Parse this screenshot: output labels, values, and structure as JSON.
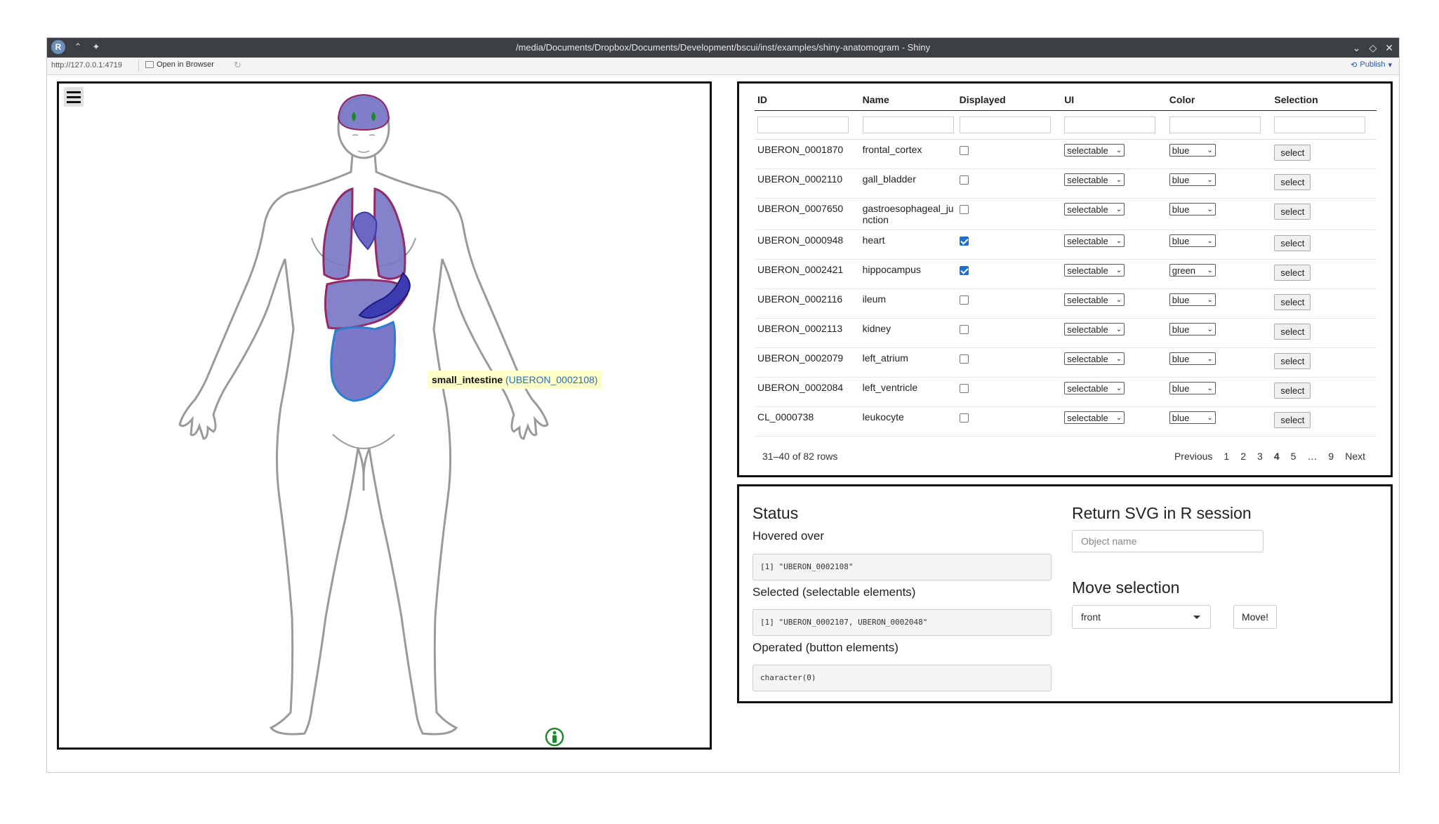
{
  "window": {
    "title": "/media/Documents/Dropbox/Documents/Development/bscui/inst/examples/shiny-anatomogram - Shiny",
    "url": "http://127.0.0.1:4719",
    "open_in_browser": "Open in Browser",
    "publish": "Publish",
    "r_logo": "R"
  },
  "anatomogram": {
    "tooltip_name": "small_intestine",
    "tooltip_id": "(UBERON_0002108)",
    "icons": [
      "menu-icon",
      "accessibility-icon"
    ]
  },
  "table": {
    "headers": [
      "ID",
      "Name",
      "Displayed",
      "UI",
      "Color",
      "Selection"
    ],
    "rows": [
      {
        "id": "UBERON_0001870",
        "name": "frontal_cortex",
        "displayed": false,
        "ui": "selectable",
        "color": "blue",
        "selection": "select"
      },
      {
        "id": "UBERON_0002110",
        "name": "gall_bladder",
        "displayed": false,
        "ui": "selectable",
        "color": "blue",
        "selection": "select"
      },
      {
        "id": "UBERON_0007650",
        "name": "gastroesophageal_junction",
        "displayed": false,
        "ui": "selectable",
        "color": "blue",
        "selection": "select"
      },
      {
        "id": "UBERON_0000948",
        "name": "heart",
        "displayed": true,
        "ui": "selectable",
        "color": "blue",
        "selection": "select"
      },
      {
        "id": "UBERON_0002421",
        "name": "hippocampus",
        "displayed": true,
        "ui": "selectable",
        "color": "green",
        "selection": "select"
      },
      {
        "id": "UBERON_0002116",
        "name": "ileum",
        "displayed": false,
        "ui": "selectable",
        "color": "blue",
        "selection": "select"
      },
      {
        "id": "UBERON_0002113",
        "name": "kidney",
        "displayed": false,
        "ui": "selectable",
        "color": "blue",
        "selection": "select"
      },
      {
        "id": "UBERON_0002079",
        "name": "left_atrium",
        "displayed": false,
        "ui": "selectable",
        "color": "blue",
        "selection": "select"
      },
      {
        "id": "UBERON_0002084",
        "name": "left_ventricle",
        "displayed": false,
        "ui": "selectable",
        "color": "blue",
        "selection": "select"
      },
      {
        "id": "CL_0000738",
        "name": "leukocyte",
        "displayed": false,
        "ui": "selectable",
        "color": "blue",
        "selection": "select"
      }
    ],
    "info": "31–40 of 82 rows",
    "pager": {
      "previous": "Previous",
      "pages": [
        "1",
        "2",
        "3",
        "4",
        "5",
        "…",
        "9"
      ],
      "current": "4",
      "next": "Next"
    }
  },
  "status": {
    "title": "Status",
    "hovered_label": "Hovered over",
    "hovered_value": "[1] \"UBERON_0002108\"",
    "selected_label": "Selected (selectable elements)",
    "selected_value": "[1] \"UBERON_0002107, UBERON_0002048\"",
    "operated_label": "Operated (button elements)",
    "operated_value": "character(0)",
    "return_title": "Return SVG in R session",
    "object_placeholder": "Object name",
    "move_title": "Move selection",
    "move_option": "front",
    "move_button": "Move!"
  },
  "colors": {
    "organ_fill": "#7b78c8",
    "organ_stroke": "#8a1a5a",
    "selected_stroke": "#1a3cb5",
    "hover_stroke": "#2a7fd0",
    "hippocampus": "#1d8a2a",
    "body_outline": "#9a9a9a",
    "titlebar": "#3c3f44"
  }
}
